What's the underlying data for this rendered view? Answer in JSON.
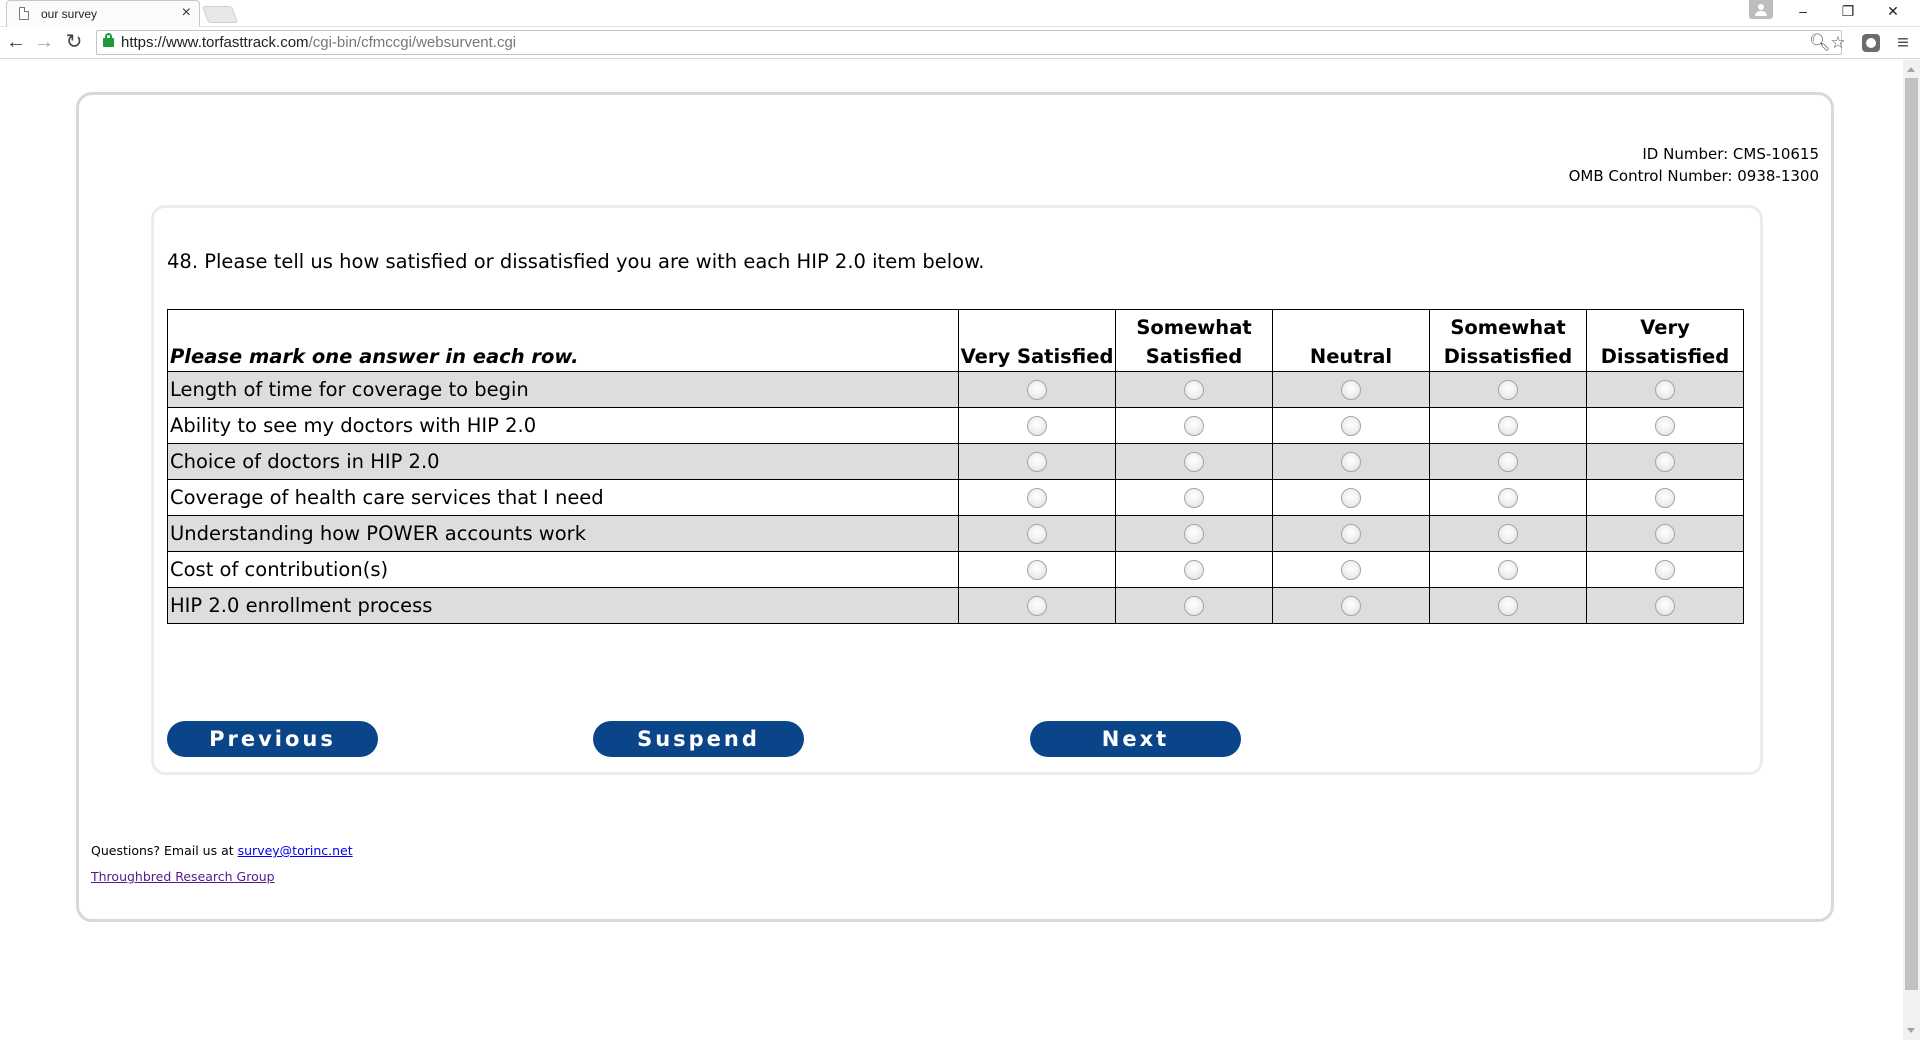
{
  "browser": {
    "tab_title": "our survey",
    "tab_close": "×",
    "url_host": "https://www.torfasttrack.com",
    "url_path": "/cgi-bin/cfmccgi/websurvent.cgi",
    "window_controls": {
      "minimize": "–",
      "restore": "❐",
      "close": "✕"
    },
    "nav": {
      "back": "←",
      "forward": "→",
      "reload": "↻"
    },
    "icons": {
      "zoom": "zoom-icon",
      "star": "star-icon",
      "menu": "menu-icon"
    }
  },
  "header": {
    "id_number": "ID Number: CMS-10615",
    "omb_number": "OMB Control Number: 0938-1300"
  },
  "question": {
    "text": "48. Please tell us how satisfied or dissatisfied you are with each HIP 2.0 item below.",
    "instruction": "Please mark one answer in each row.",
    "columns": [
      {
        "line1": "",
        "line2": "Very Satisfied"
      },
      {
        "line1": "Somewhat",
        "line2": "Satisfied"
      },
      {
        "line1": "",
        "line2": "Neutral"
      },
      {
        "line1": "Somewhat",
        "line2": "Dissatisfied"
      },
      {
        "line1": "Very",
        "line2": "Dissatisfied"
      }
    ],
    "rows": [
      "Length of time for coverage to begin",
      "Ability to see my doctors with HIP 2.0",
      "Choice of doctors in HIP 2.0",
      "Coverage of health care services that I need",
      "Understanding how POWER accounts work",
      "Cost of contribution(s)",
      "HIP 2.0 enrollment process"
    ]
  },
  "buttons": {
    "previous": "Previous",
    "suspend": "Suspend",
    "next": "Next"
  },
  "footer": {
    "questions_prefix": "Questions? Email us at ",
    "email": "survey@torinc.net",
    "org_link": "Throughbred Research Group"
  },
  "colors": {
    "button_bg": "#0b4589",
    "row_shade": "#dddddd",
    "panel_border": "#d9d9d9"
  }
}
